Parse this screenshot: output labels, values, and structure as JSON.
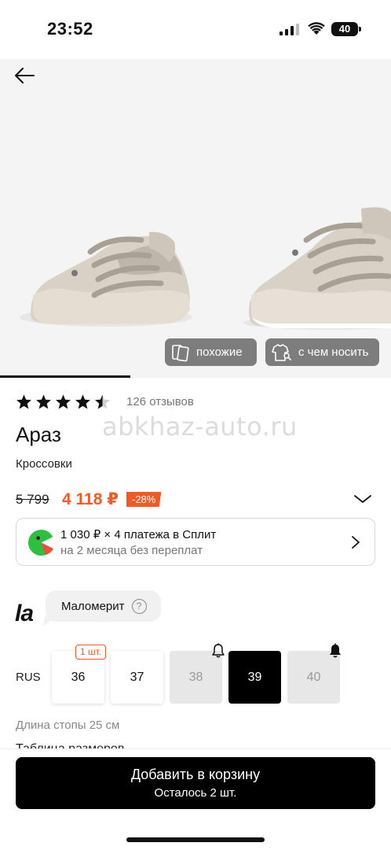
{
  "status_bar": {
    "time": "23:52",
    "battery": "40"
  },
  "gallery": {
    "similar_label": "похожие",
    "outfit_label": "с чем носить",
    "image_index": 1,
    "image_count": 3
  },
  "rating": {
    "stars": 4.5,
    "reviews": "126 отзывов"
  },
  "product": {
    "brand": "Араз",
    "category": "Кроссовки",
    "watermark": "abkhaz-auto.ru"
  },
  "price": {
    "old": "5 799",
    "new": "4 118 ₽",
    "discount": "-28%"
  },
  "split": {
    "line1": "1 030 ₽ × 4 платежа в Сплит",
    "line2": "на 2 месяца без переплат"
  },
  "fit": {
    "logo": "la",
    "label": "Маломерит",
    "help": "?"
  },
  "sizes": {
    "region": "RUS",
    "stock_tag": "1 шт.",
    "items": [
      {
        "label": "36",
        "state": "available"
      },
      {
        "label": "37",
        "state": "available"
      },
      {
        "label": "38",
        "state": "unavailable"
      },
      {
        "label": "39",
        "state": "selected"
      },
      {
        "label": "40",
        "state": "unavailable"
      }
    ],
    "foot_length": "Длина стопы 25 см",
    "table_link": "Таблица размеров"
  },
  "cart": {
    "label": "Добавить в корзину",
    "sublabel": "Осталось 2 шт."
  },
  "colors": {
    "accent": "#f15a24",
    "split_green": "#2fbf3e",
    "selected_bg": "#000000"
  }
}
